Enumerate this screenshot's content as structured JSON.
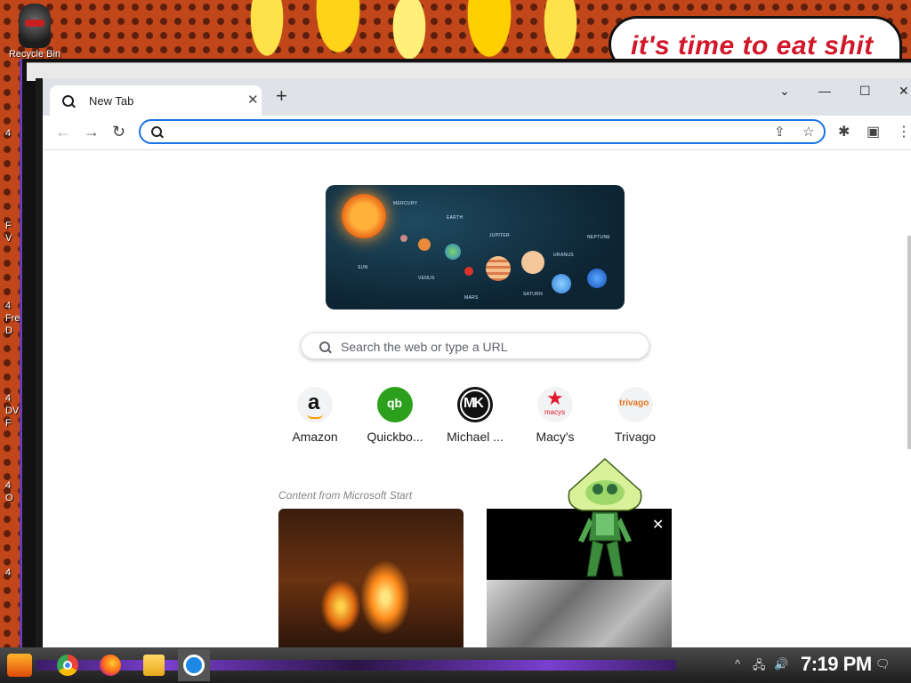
{
  "desktop": {
    "speech_bubble": "it's time to eat shit",
    "recycle_bin_label": "Recycle Bin",
    "left_icon_fragments": [
      "4",
      "F",
      "V",
      "4",
      "Fre",
      "D",
      "4",
      "DV",
      "F",
      "4",
      "O",
      "4"
    ]
  },
  "browser": {
    "tab": {
      "title": "New Tab",
      "close": "✕"
    },
    "new_tab": "+",
    "window_controls": {
      "dropdown": "⌄",
      "minimize": "—",
      "maximize": "☐",
      "close": "✕"
    },
    "nav": {
      "back": "←",
      "forward": "→",
      "reload": "↻"
    },
    "omnibox": {
      "value": "",
      "share_icon": "⇪",
      "star_icon": "☆"
    },
    "toolbar_icons": {
      "extensions": "✱",
      "sidepanel": "▣",
      "menu": "⋮"
    }
  },
  "newtab": {
    "doodle": {
      "labels": {
        "sun": "SUN",
        "mercury": "MERCURY",
        "venus": "VENUS",
        "earth": "EARTH",
        "mars": "MARS",
        "jupiter": "JUPITER",
        "saturn": "SATURN",
        "uranus": "URANUS",
        "neptune": "NEPTUNE"
      }
    },
    "search_placeholder": "Search the web or type a URL",
    "shortcuts": [
      {
        "label": "Amazon",
        "icon_text": "a"
      },
      {
        "label": "Quickbo...",
        "icon_text": "qb"
      },
      {
        "label": "Michael ...",
        "icon_text": "MK"
      },
      {
        "label": "Macy's",
        "icon_text": "macys"
      },
      {
        "label": "Trivago",
        "icon_text": "trivago"
      }
    ],
    "content_label": "Content from Microsoft Start",
    "card_close": "✕"
  },
  "taskbar": {
    "clock": "7:19 PM",
    "tray": {
      "chevron": "^",
      "network": "🖧",
      "volume": "🔊",
      "notifications": "🗨"
    }
  }
}
